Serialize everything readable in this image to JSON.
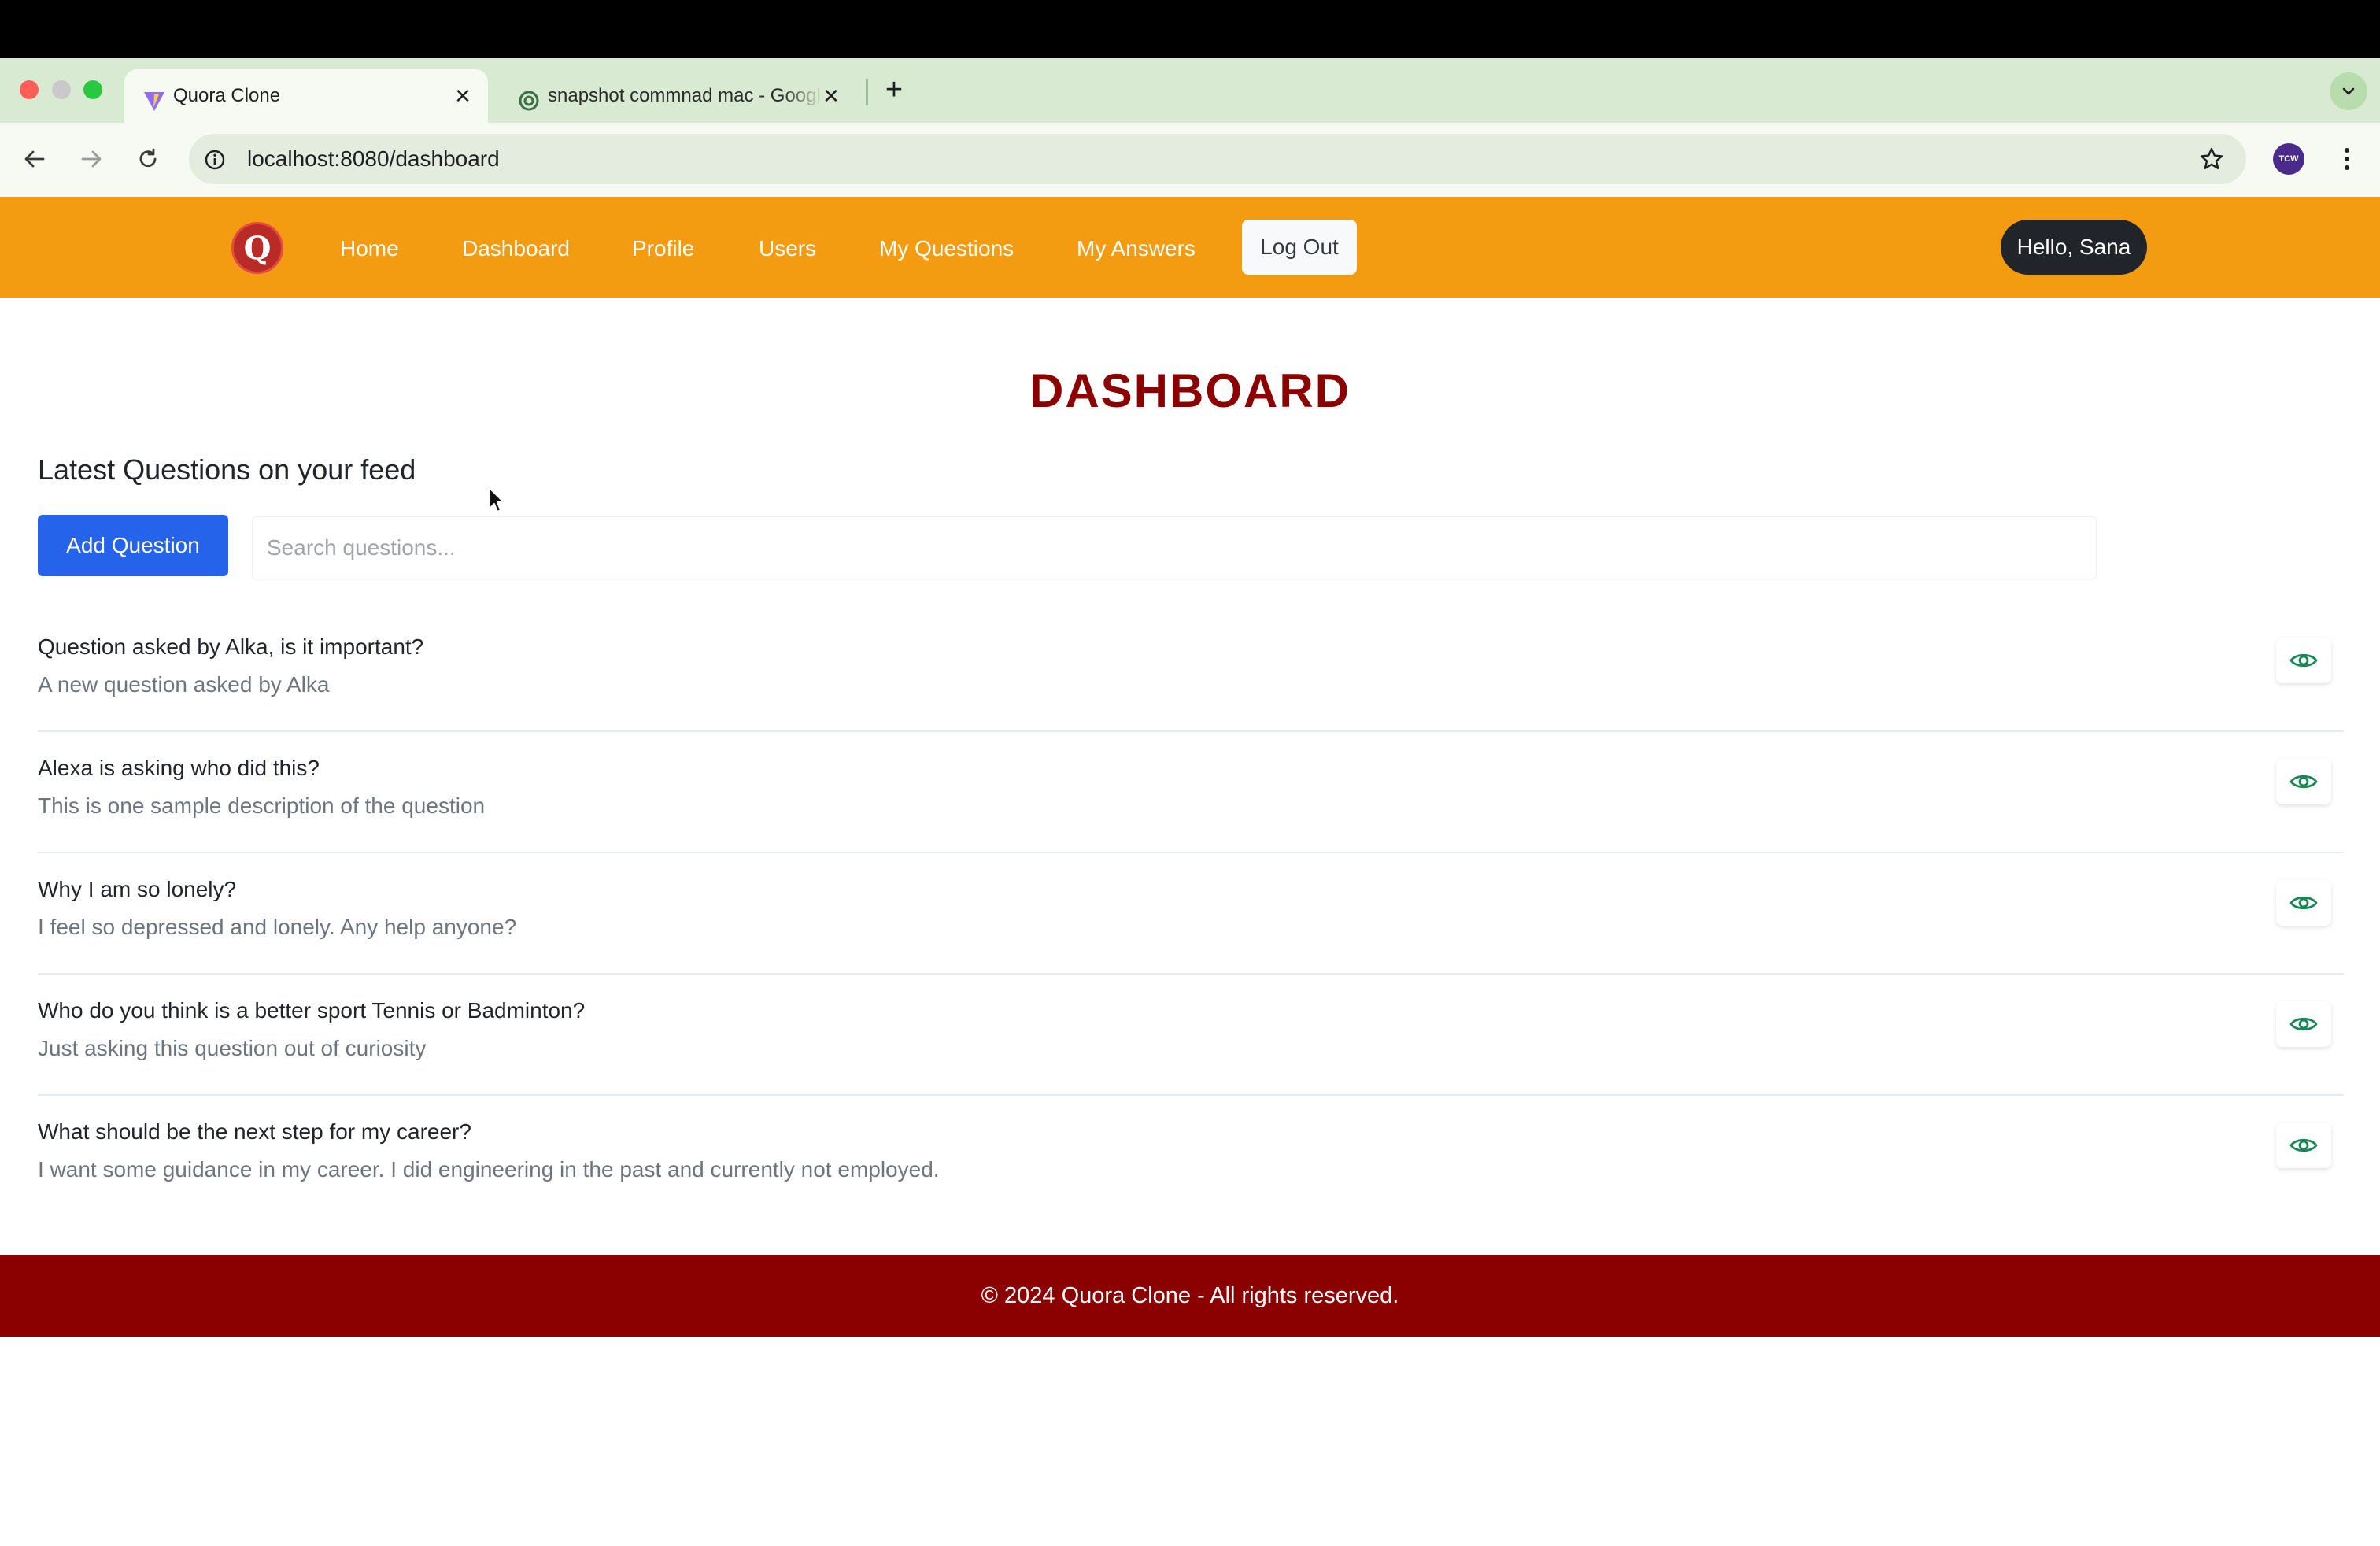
{
  "browser": {
    "tabs": [
      {
        "title": "Quora Clone",
        "active": true
      },
      {
        "title": "snapshot commnad mac - Google Search",
        "active": false
      }
    ],
    "url": "localhost:8080/dashboard",
    "profile_initials": "TCW"
  },
  "navbar": {
    "logo_letter": "Q",
    "links": [
      "Home",
      "Dashboard",
      "Profile",
      "Users",
      "My Questions",
      "My Answers"
    ],
    "logout_label": "Log Out",
    "greeting": "Hello, Sana"
  },
  "main": {
    "title": "DASHBOARD",
    "feed_heading": "Latest Questions on your feed",
    "add_button": "Add Question",
    "search_placeholder": "Search questions...",
    "questions": [
      {
        "title": "Question asked by Alka, is it important?",
        "description": "A new question asked by Alka"
      },
      {
        "title": "Alexa is asking who did this?",
        "description": "This is one sample description of the question"
      },
      {
        "title": "Why I am so lonely?",
        "description": "I feel so depressed and lonely. Any help anyone?"
      },
      {
        "title": "Who do you think is a better sport Tennis or Badminton?",
        "description": "Just asking this question out of curiosity"
      },
      {
        "title": "What should be the next step for my career?",
        "description": "I want some guidance in my career. I did engineering in the past and currently not employed."
      }
    ]
  },
  "footer": {
    "text": "© 2024 Quora Clone - All rights reserved."
  },
  "colors": {
    "navbar": "#f39c12",
    "title": "#8b0000",
    "footer": "#8b0000",
    "primary_button": "#2563eb",
    "view_icon": "#198754"
  }
}
